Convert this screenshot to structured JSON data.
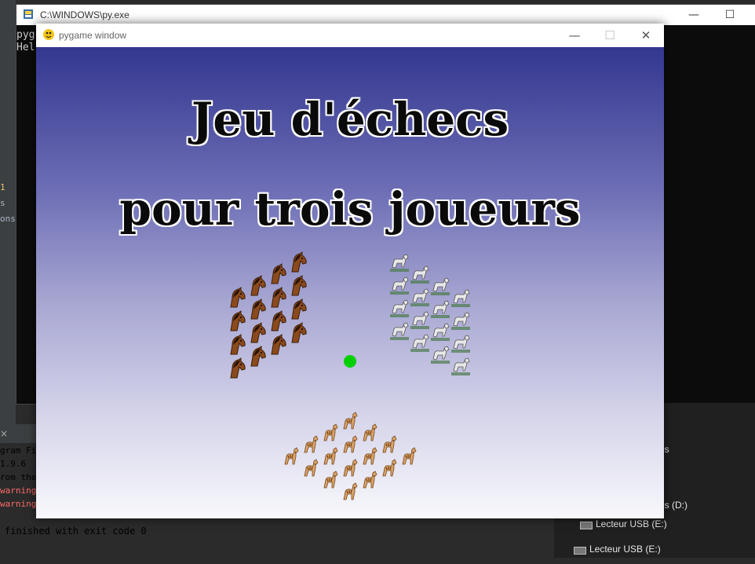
{
  "ide": {
    "left_strip": [
      "1",
      "s",
      "ons"
    ],
    "run_lines": [
      {
        "text": "gram Fi",
        "color": "#a9b7c6"
      },
      {
        "text": "1.9.6",
        "color": "#a9b7c6"
      },
      {
        "text": "rom the",
        "color": "#a9b7c6"
      },
      {
        "text": "warning",
        "color": "#ff6b68"
      },
      {
        "text": "warning",
        "color": "#ff6b68"
      }
    ],
    "finished_text": "finished with exit code 0",
    "close_glyph": "×"
  },
  "console": {
    "title": "C:\\WINDOWS\\py.exe",
    "icon": "python-icon",
    "lines": [
      "pyg",
      "Hel"
    ],
    "minimize": "—",
    "maximize": "☐"
  },
  "explorer": {
    "items": [
      {
        "label": "es",
        "icon": ""
      },
      {
        "label": "es (D:)",
        "icon": ""
      },
      {
        "label": "Lecteur USB (E:)",
        "icon": "usb-drive-icon"
      },
      {
        "label": "Lecteur USB (E:)",
        "icon": "usb-drive-icon"
      }
    ]
  },
  "pygame_window": {
    "title": "pygame window",
    "icon": "pygame-snake-icon",
    "minimize": "—",
    "maximize": "☐",
    "close": "✕",
    "game": {
      "title_line1": "Jeu d'échecs",
      "title_line2": "pour trois joueurs",
      "center_marker_color": "#00d000",
      "armies": [
        {
          "name": "brown-horse-army",
          "icon": "brown-horse-head-icon",
          "count": 16,
          "color": "#8b4a1c"
        },
        {
          "name": "white-horse-army",
          "icon": "white-horse-icon",
          "count": 16,
          "color": "#e8e8e8"
        },
        {
          "name": "zebra-horse-army",
          "icon": "zebra-horse-icon",
          "count": 16,
          "color": "#d9a36a"
        }
      ]
    }
  }
}
